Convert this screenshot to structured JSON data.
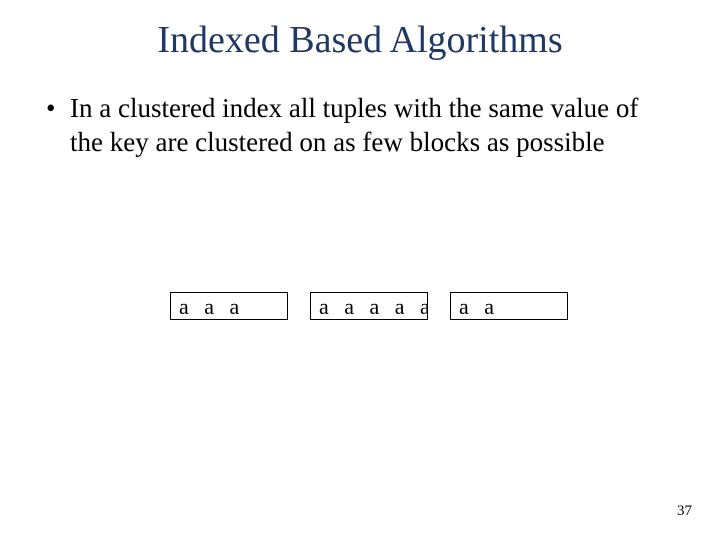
{
  "title": "Indexed Based Algorithms",
  "bullet": {
    "marker": "•",
    "text": "In a clustered index all tuples with the same value of the key are clustered on as few blocks as possible"
  },
  "blocks": [
    "a a a",
    "a a a a a",
    "a a"
  ],
  "page_number": "37"
}
